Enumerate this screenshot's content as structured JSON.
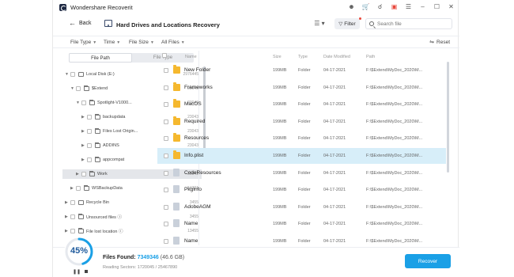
{
  "app": {
    "title": "Wondershare Recoverit"
  },
  "nav": {
    "back_label": "Back",
    "page_title": "Hard Drives and Locations Recovery",
    "filter_label": "Filter",
    "search_placeholder": "Search file"
  },
  "filters": {
    "file_type": "File Type",
    "time": "Time",
    "file_size": "File Size",
    "all_files": "All Files",
    "reset": "Reset"
  },
  "left_tabs": {
    "file_path": "File Path",
    "file_type": "File Type"
  },
  "tree": [
    {
      "label": "Local Disk (E:)",
      "count": "2976445"
    },
    {
      "label": "$Extend",
      "count": "23043"
    },
    {
      "label": "Spotlight-V1000...",
      "count": "23043"
    },
    {
      "label": "backupdata",
      "count": "23043"
    },
    {
      "label": "Files Lost Origin...",
      "count": "23043"
    },
    {
      "label": "ADDINS",
      "count": "23043"
    },
    {
      "label": "appcompat",
      "count": "23043"
    },
    {
      "label": "Work",
      "count": "23043"
    },
    {
      "label": "WSBackupData",
      "count": "54321"
    },
    {
      "label": "Recycle Bin",
      "count": "3455"
    },
    {
      "label": "Unsourced files",
      "count": "3455"
    },
    {
      "label": "File lost location",
      "count": "13455"
    }
  ],
  "table": {
    "headers": {
      "name": "Name",
      "size": "Size",
      "type": "Type",
      "date": "Date Modified",
      "path": "Path"
    },
    "rows": [
      {
        "name": "New Folder",
        "size": "199MB",
        "type": "Folder",
        "date": "04-17-2021",
        "path": "F:\\$Extend\\MyDoc_2020\\M...",
        "icon": "folder"
      },
      {
        "name": "Frameworks",
        "size": "199MB",
        "type": "Folder",
        "date": "04-17-2021",
        "path": "F:\\$Extend\\MyDoc_2020\\M...",
        "icon": "folder"
      },
      {
        "name": "MacOS",
        "size": "199MB",
        "type": "Folder",
        "date": "04-17-2021",
        "path": "F:\\$Extend\\MyDoc_2020\\M...",
        "icon": "folder"
      },
      {
        "name": "Required",
        "size": "199MB",
        "type": "Folder",
        "date": "04-17-2021",
        "path": "F:\\$Extend\\MyDoc_2020\\M...",
        "icon": "folder"
      },
      {
        "name": "Resources",
        "size": "199MB",
        "type": "Folder",
        "date": "04-17-2021",
        "path": "F:\\$Extend\\MyDoc_2020\\M...",
        "icon": "folder"
      },
      {
        "name": "Info.plist",
        "size": "199MB",
        "type": "Folder",
        "date": "04-17-2021",
        "path": "F:\\$Extend\\MyDoc_2020\\M...",
        "icon": "folder"
      },
      {
        "name": "CodeResources",
        "size": "199MB",
        "type": "Folder",
        "date": "04-17-2021",
        "path": "F:\\$Extend\\MyDoc_2020\\M...",
        "icon": "file"
      },
      {
        "name": "PkgInfo",
        "size": "199MB",
        "type": "Folder",
        "date": "04-17-2021",
        "path": "F:\\$Extend\\MyDoc_2020\\M...",
        "icon": "file"
      },
      {
        "name": "AdobeAGM",
        "size": "199MB",
        "type": "Folder",
        "date": "04-17-2021",
        "path": "F:\\$Extend\\MyDoc_2020\\M...",
        "icon": "file"
      },
      {
        "name": "Name",
        "size": "199MB",
        "type": "Folder",
        "date": "04-17-2021",
        "path": "F:\\$Extend\\MyDoc_2020\\M...",
        "icon": "file"
      },
      {
        "name": "Name",
        "size": "199MB",
        "type": "Folder",
        "date": "04-17-2021",
        "path": "F:\\$Extend\\MyDoc_2020\\M...",
        "icon": "file"
      }
    ]
  },
  "footer": {
    "progress_percent": 45,
    "progress_text": "45%",
    "files_found_label": "Files Found:",
    "files_found_count": "7349346",
    "files_found_size": "(46.6 GB)",
    "reading_sectors": "Reading Sectors: 1720045 / 25467890",
    "recover_label": "Recover"
  },
  "colors": {
    "accent": "#1aa0e6",
    "folder": "#f5b82e",
    "selected_row": "#d7eef9",
    "progress": "#1e5a9c"
  }
}
